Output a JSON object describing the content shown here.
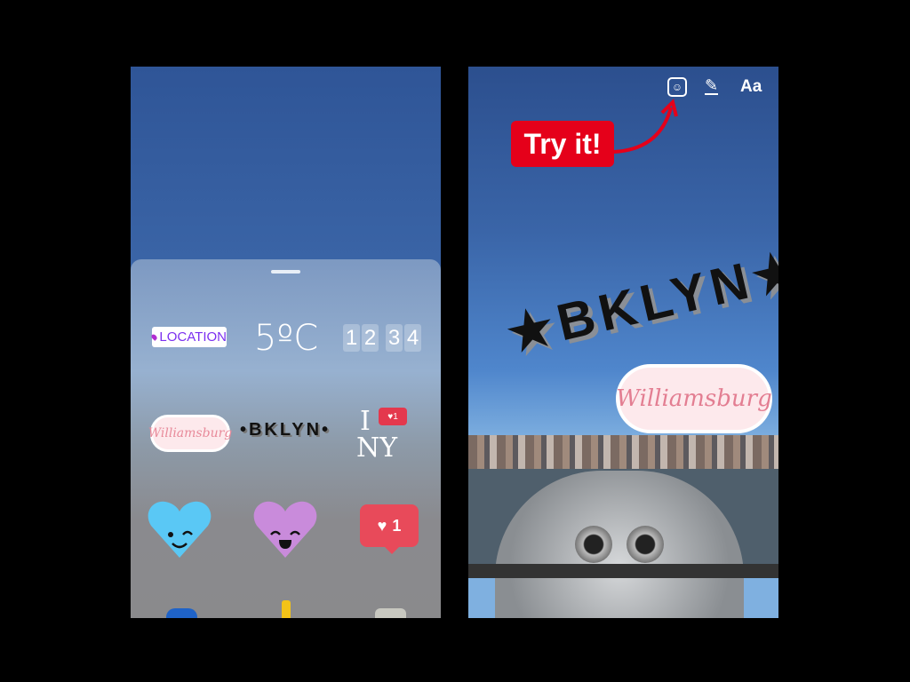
{
  "left": {
    "stickers": {
      "location": "LOCATION",
      "temperature": "5ºC",
      "clock": [
        "1",
        "2",
        "3",
        "4"
      ],
      "williamsburg": "Williamsburg",
      "bklyn": "•BKLYN•",
      "i_ny": {
        "i": "I",
        "ny": "NY",
        "like": "♥1"
      },
      "like": {
        "heart": "♥",
        "count": "1"
      }
    }
  },
  "right": {
    "toolbar": {
      "sticker": "☺",
      "pen": "✎",
      "text": "Aa"
    },
    "callout": "Try it!",
    "bklyn": "★BKLYN★",
    "williamsburg": "Williamsburg"
  },
  "colors": {
    "callout": "#e5001a",
    "like": "#e84a5a",
    "heart_blue": "#5ac8f5",
    "heart_purple": "#c98bdb"
  }
}
